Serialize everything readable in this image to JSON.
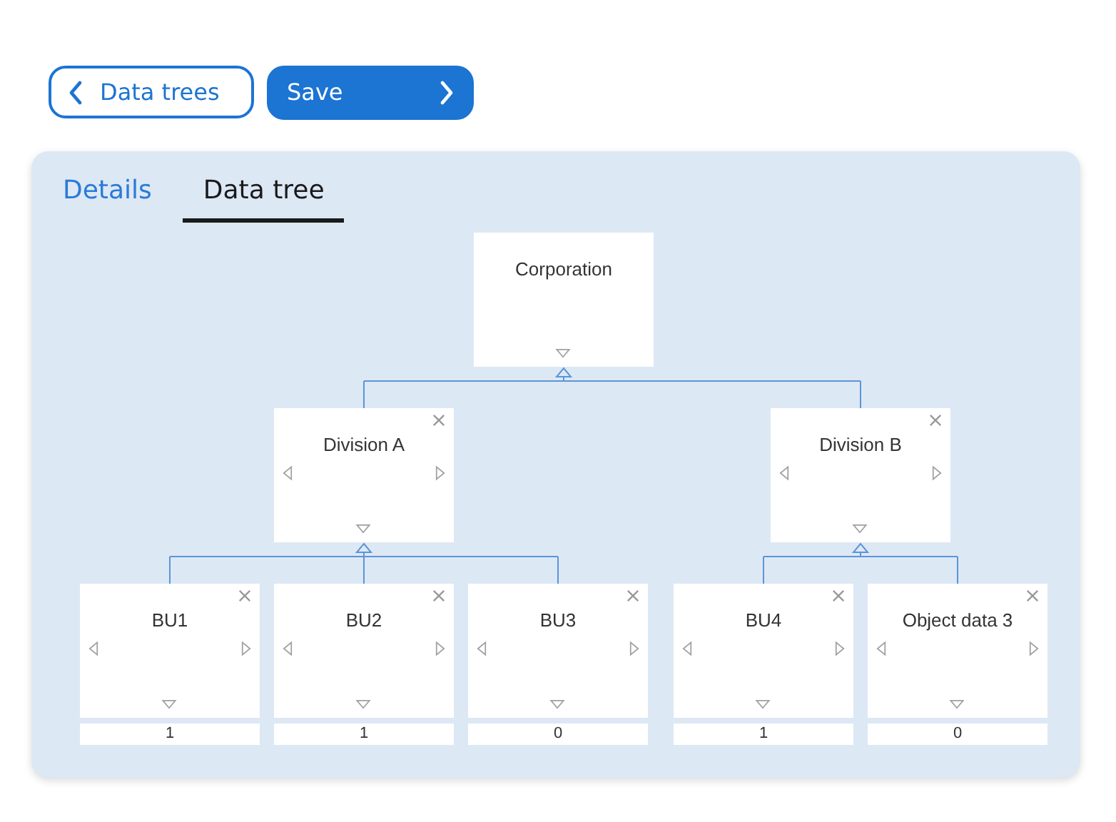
{
  "buttons": [
    {
      "kind": "back",
      "label": "Data trees"
    },
    {
      "kind": "primary",
      "label": "Save"
    }
  ],
  "tabs": [
    {
      "label": "Details",
      "selected": false
    },
    {
      "label": "Data tree",
      "selected": true
    }
  ],
  "tree": {
    "name": "Corporation",
    "removable": false,
    "children": [
      {
        "name": "Division A",
        "removable": true,
        "children": [
          {
            "name": "BU1",
            "removable": true,
            "count": "1"
          },
          {
            "name": "BU2",
            "removable": true,
            "count": "1"
          },
          {
            "name": "BU3",
            "removable": true,
            "count": "0"
          }
        ]
      },
      {
        "name": "Division B",
        "removable": true,
        "children": [
          {
            "name": "BU4",
            "removable": true,
            "count": "1"
          },
          {
            "name": "Object data 3",
            "removable": true,
            "count": "0"
          }
        ]
      }
    ]
  }
}
